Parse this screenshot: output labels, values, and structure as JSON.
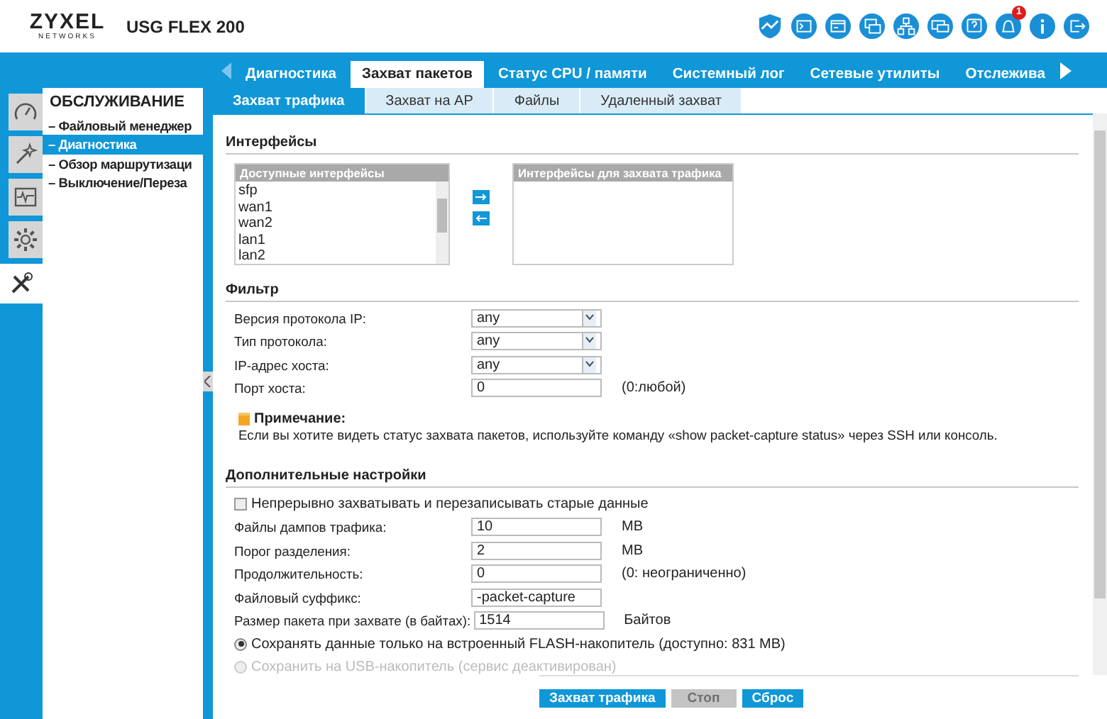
{
  "header": {
    "logo": "ZYXEL",
    "logo_sub": "NETWORKS",
    "model": "USG FLEX 200",
    "icons": [
      {
        "kind": "shield"
      },
      {
        "kind": "console"
      },
      {
        "kind": "cli"
      },
      {
        "kind": "windows"
      },
      {
        "kind": "network"
      },
      {
        "kind": "chat"
      },
      {
        "kind": "help"
      },
      {
        "kind": "bell",
        "badge": "1"
      },
      {
        "kind": "info"
      },
      {
        "kind": "logout"
      }
    ]
  },
  "tabs": [
    {
      "label": "Диагностика",
      "selected": false
    },
    {
      "label": "Захват пакетов",
      "selected": true
    },
    {
      "label": "Статус CPU / памяти",
      "selected": false
    },
    {
      "label": "Системный лог",
      "selected": false
    },
    {
      "label": "Сетевые утилиты",
      "selected": false
    },
    {
      "label": "Отслежива",
      "selected": false
    }
  ],
  "subtabs": [
    {
      "label": "Захват трафика",
      "selected": true
    },
    {
      "label": "Захват на AP",
      "selected": false
    },
    {
      "label": "Файлы",
      "selected": false
    },
    {
      "label": "Удаленный захват",
      "selected": false
    }
  ],
  "sidebar": {
    "icons": [
      {
        "kind": "dashboard",
        "selected": false
      },
      {
        "kind": "wizard",
        "selected": false
      },
      {
        "kind": "monitor",
        "selected": false
      },
      {
        "kind": "gear",
        "selected": false
      },
      {
        "kind": "tools",
        "selected": true
      }
    ],
    "title": "ОБСЛУЖИВАНИЕ",
    "items": [
      {
        "label": "– Файловый менеджер",
        "selected": false
      },
      {
        "label": "– Диагностика",
        "selected": true
      },
      {
        "label": "– Обзор маршрутизаци",
        "selected": false
      },
      {
        "label": "– Выключение/Переза",
        "selected": false
      }
    ]
  },
  "interfaces": {
    "title": "Интерфейсы",
    "available": {
      "header": "Доступные интерфейсы",
      "items": [
        "sfp",
        "wan1",
        "wan2",
        "lan1",
        "lan2"
      ]
    },
    "captured": {
      "header": "Интерфейсы для захвата трафика"
    }
  },
  "filter": {
    "title": "Фильтр",
    "rows": [
      {
        "kind": "select",
        "label": "Версия протокола IP:",
        "value": "any"
      },
      {
        "kind": "select",
        "label": "Тип протокола:",
        "value": "any"
      },
      {
        "kind": "select",
        "label": "IP-адрес хоста:",
        "value": "any"
      },
      {
        "kind": "input",
        "label": "Порт хоста:",
        "value": "0",
        "hint": "(0:любой)"
      }
    ]
  },
  "note": {
    "title": "Примечание:",
    "text": "Если вы хотите видеть статус захвата пакетов, используйте команду «show packet-capture status» через SSH или консоль."
  },
  "advanced": {
    "title": "Дополнительные настройки",
    "rows": [
      {
        "kind": "checkbox",
        "label": "Непрерывно захватывать и перезаписывать старые данные",
        "checked": false
      },
      {
        "kind": "input",
        "label": "Файлы дампов трафика:",
        "value": "10",
        "hint": "MB"
      },
      {
        "kind": "input",
        "label": "Порог разделения:",
        "value": "2",
        "hint": "MB"
      },
      {
        "kind": "input",
        "label": "Продолжительность:",
        "value": "0",
        "hint": "(0: неограниченно)"
      },
      {
        "kind": "input",
        "label": "Файловый суффикс:",
        "value": "-packet-capture"
      },
      {
        "kind": "input",
        "label": "Размер пакета при захвате (в байтах):",
        "value": "1514",
        "hint": "Байтов"
      },
      {
        "kind": "radio",
        "label": "Сохранять данные только на встроенный FLASH-накопитель (доступно: 831 MB)",
        "selected": true,
        "disabled": false
      },
      {
        "kind": "radio",
        "label": "Сохранить на USB-накопитель (сервис деактивирован)",
        "selected": false,
        "disabled": true
      }
    ]
  },
  "buttons": [
    {
      "label": "Захват трафика",
      "disabled": false
    },
    {
      "label": "Стоп",
      "disabled": true
    },
    {
      "label": "Сброс",
      "disabled": false
    }
  ]
}
